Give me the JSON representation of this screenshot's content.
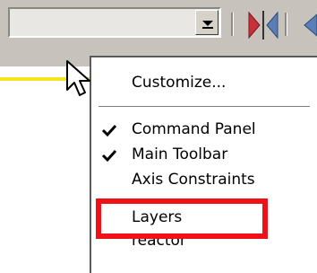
{
  "toolbar": {
    "combo_value": "",
    "icons": [
      "dropdown-arrow-icon",
      "mirror-icon",
      "align-icon"
    ]
  },
  "context_menu": {
    "items": [
      {
        "label": "Customize...",
        "checked": false
      },
      {
        "label": "Command Panel",
        "checked": true
      },
      {
        "label": "Main Toolbar",
        "checked": true
      },
      {
        "label": "Axis Constraints",
        "checked": false
      },
      {
        "label": "Layers",
        "checked": false
      },
      {
        "label": "reactor",
        "checked": false
      }
    ]
  },
  "colors": {
    "toolbar_bg": "#c7c3bc",
    "highlight": "#ef1018",
    "accent_yellow": "#f2e41e",
    "mirror_red": "#c8303a",
    "mirror_blue": "#5a7fb7"
  }
}
